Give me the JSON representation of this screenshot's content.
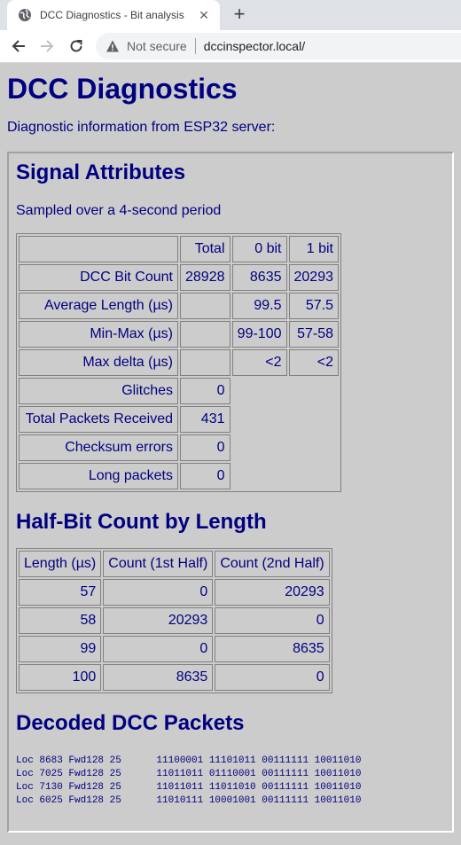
{
  "browser": {
    "tab_title": "DCC Diagnostics - Bit analysis",
    "security_label": "Not secure",
    "url": "dccinspector.local/"
  },
  "page": {
    "title": "DCC Diagnostics",
    "intro": "Diagnostic information from ESP32 server:"
  },
  "signal": {
    "heading": "Signal Attributes",
    "subtitle": "Sampled over a 4-second period",
    "header": [
      "",
      "Total",
      "0 bit",
      "1 bit"
    ],
    "rows": [
      [
        "DCC Bit Count",
        "28928",
        "8635",
        "20293"
      ],
      [
        "Average Length (µs)",
        "",
        "99.5",
        "57.5"
      ],
      [
        "Min-Max (µs)",
        "",
        "99-100",
        "57-58"
      ],
      [
        "Max delta (µs)",
        "",
        "<2",
        "<2"
      ]
    ],
    "stats": [
      [
        "Glitches",
        "0"
      ],
      [
        "Total Packets Received",
        "431"
      ],
      [
        "Checksum errors",
        "0"
      ],
      [
        "Long packets",
        "0"
      ]
    ]
  },
  "halfbit": {
    "heading": "Half-Bit Count by Length",
    "header": [
      "Length (µs)",
      "Count (1st Half)",
      "Count (2nd Half)"
    ],
    "rows": [
      [
        "57",
        "0",
        "20293"
      ],
      [
        "58",
        "20293",
        "0"
      ],
      [
        "99",
        "0",
        "8635"
      ],
      [
        "100",
        "8635",
        "0"
      ]
    ]
  },
  "packets": {
    "heading": "Decoded DCC Packets",
    "lines": [
      "Loc 8683 Fwd128 25      11100001 11101011 00111111 10011010",
      "Loc 7025 Fwd128 25      11011011 01110001 00111111 10011010",
      "Loc 7130 Fwd128 25      11011011 11011010 00111111 10011010",
      "Loc 6025 Fwd128 25      11010111 10001001 00111111 10011010"
    ]
  }
}
